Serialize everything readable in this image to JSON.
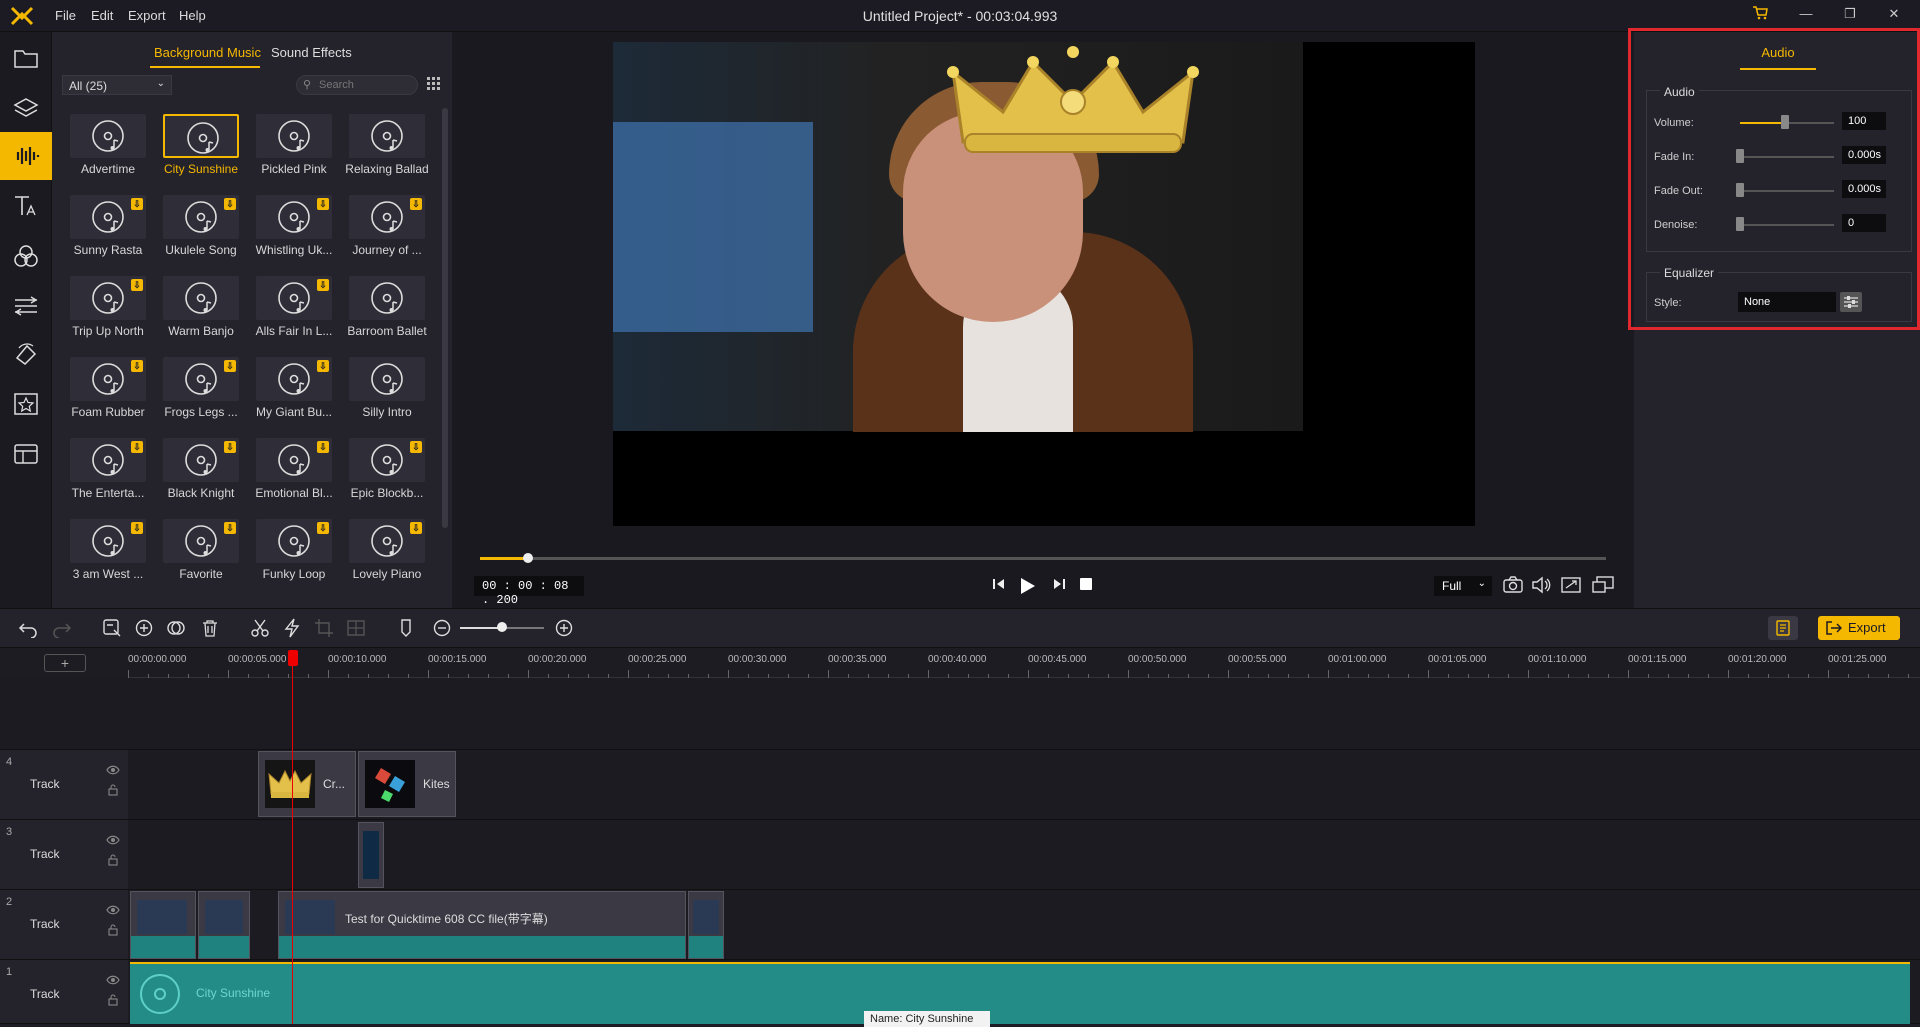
{
  "app": {
    "title": "Untitled Project* - 00:03:04.993",
    "menu": [
      "File",
      "Edit",
      "Export",
      "Help"
    ]
  },
  "library": {
    "tabs": [
      "Background Music",
      "Sound Effects"
    ],
    "filter": "All (25)",
    "search_placeholder": "Search",
    "items": [
      {
        "label": "Advertime",
        "download": false
      },
      {
        "label": "City Sunshine",
        "download": false,
        "selected": true
      },
      {
        "label": "Pickled Pink",
        "download": false
      },
      {
        "label": "Relaxing Ballad",
        "download": false
      },
      {
        "label": "Sunny Rasta",
        "download": true
      },
      {
        "label": "Ukulele Song",
        "download": true
      },
      {
        "label": "Whistling Uk...",
        "download": true
      },
      {
        "label": "Journey of ...",
        "download": true
      },
      {
        "label": "Trip Up North",
        "download": true
      },
      {
        "label": "Warm Banjo",
        "download": false
      },
      {
        "label": "Alls Fair In L...",
        "download": true
      },
      {
        "label": "Barroom Ballet",
        "download": false
      },
      {
        "label": "Foam Rubber",
        "download": true
      },
      {
        "label": "Frogs Legs ...",
        "download": true
      },
      {
        "label": "My Giant Bu...",
        "download": true
      },
      {
        "label": "Silly Intro",
        "download": false
      },
      {
        "label": "The Enterta...",
        "download": true
      },
      {
        "label": "Black Knight",
        "download": true
      },
      {
        "label": "Emotional Bl...",
        "download": true
      },
      {
        "label": "Epic Blockb...",
        "download": true
      },
      {
        "label": "3 am West ...",
        "download": true
      },
      {
        "label": "Favorite",
        "download": true
      },
      {
        "label": "Funky Loop",
        "download": true
      },
      {
        "label": "Lovely Piano",
        "download": true
      }
    ]
  },
  "player": {
    "timecode": "00 : 00 : 08 . 200",
    "zoom": "Full",
    "progress": 0.043
  },
  "properties": {
    "tab": "Audio",
    "audio_section": "Audio",
    "volume_label": "Volume:",
    "volume_value": "100",
    "fade_in_label": "Fade In:",
    "fade_in_value": "0.000s",
    "fade_out_label": "Fade Out:",
    "fade_out_value": "0.000s",
    "denoise_label": "Denoise:",
    "denoise_value": "0",
    "equalizer_section": "Equalizer",
    "style_label": "Style:",
    "style_value": "None"
  },
  "toolbar": {
    "export_label": "Export"
  },
  "timeline": {
    "ruler": [
      "00:00:00.000",
      "00:00:05.000",
      "00:00:10.000",
      "00:00:15.000",
      "00:00:20.000",
      "00:00:25.000",
      "00:00:30.000",
      "00:00:35.000",
      "00:00:40.000",
      "00:00:45.000",
      "00:00:50.000",
      "00:00:55.000",
      "00:01:00.000",
      "00:01:05.000",
      "00:01:10.000",
      "00:01:15.000",
      "00:01:20.000",
      "00:01:25.000"
    ],
    "tracks": [
      {
        "num": "4",
        "name": "Track"
      },
      {
        "num": "3",
        "name": "Track"
      },
      {
        "num": "2",
        "name": "Track"
      },
      {
        "num": "1",
        "name": "Track"
      }
    ],
    "clip_crown": "Cr...",
    "clip_kites": "Kites",
    "clip_video": "Test for Quicktime 608 CC file(带字幕)",
    "clip_audio": "City Sunshine",
    "tooltip": "Name: City Sunshine"
  },
  "colors": {
    "accent": "#f5b800",
    "highlight_box": "#e0282e",
    "audio_clip": "#238c86"
  }
}
